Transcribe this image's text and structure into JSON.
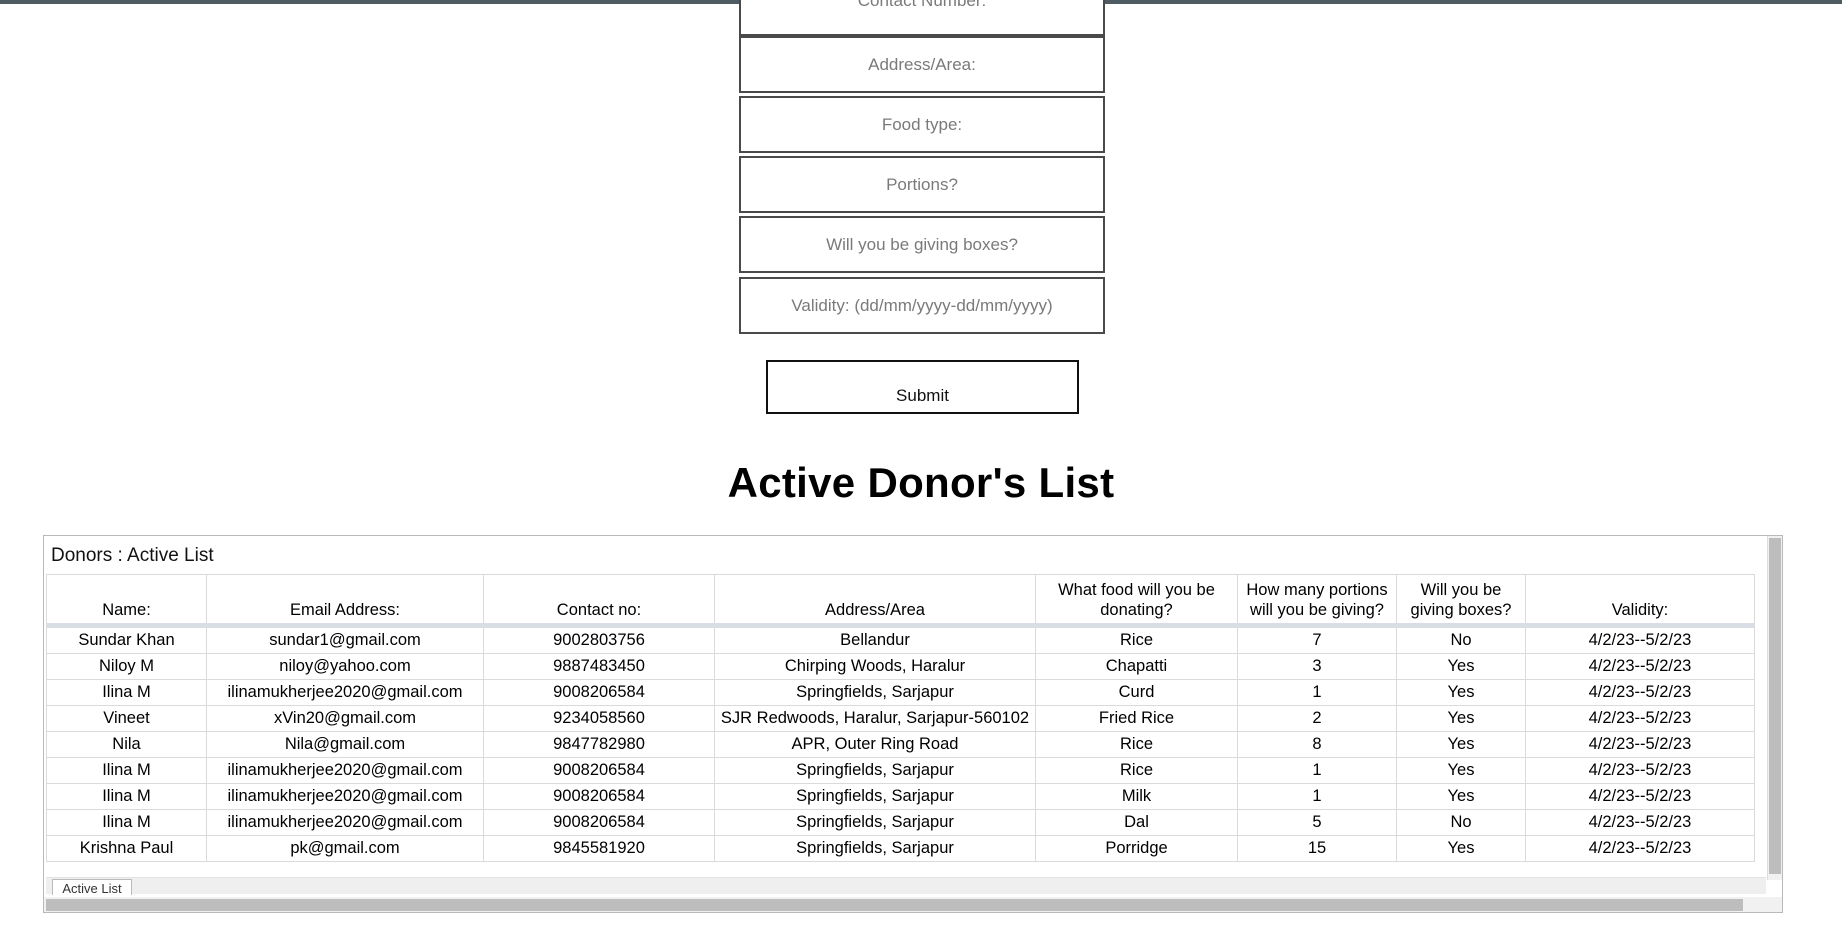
{
  "form": {
    "contact_placeholder": "Contact Number:",
    "address_placeholder": "Address/Area:",
    "food_placeholder": "Food type:",
    "portions_placeholder": "Portions?",
    "boxes_placeholder": "Will you be giving boxes?",
    "validity_placeholder": "Validity: (dd/mm/yyyy-dd/mm/yyyy)",
    "submit_label": "Submit"
  },
  "heading": "Active Donor's List",
  "sheet": {
    "title": "Donors : Active List",
    "tab_label": "Active List",
    "columns": [
      "Name:",
      "Email Address:",
      "Contact no:",
      "Address/Area",
      "What food will you be donating?",
      "How many portions will you be giving?",
      "Will you be giving boxes?",
      "Validity:"
    ],
    "rows": [
      [
        "Sundar Khan",
        "sundar1@gmail.com",
        "9002803756",
        "Bellandur",
        "Rice",
        "7",
        "No",
        "4/2/23--5/2/23"
      ],
      [
        "Niloy M",
        "niloy@yahoo.com",
        "9887483450",
        "Chirping Woods, Haralur",
        "Chapatti",
        "3",
        "Yes",
        "4/2/23--5/2/23"
      ],
      [
        "Ilina M",
        "ilinamukherjee2020@gmail.com",
        "9008206584",
        "Springfields, Sarjapur",
        "Curd",
        "1",
        "Yes",
        "4/2/23--5/2/23"
      ],
      [
        "Vineet",
        "xVin20@gmail.com",
        "9234058560",
        "SJR Redwoods, Haralur, Sarjapur-560102",
        "Fried Rice",
        "2",
        "Yes",
        "4/2/23--5/2/23"
      ],
      [
        "Nila",
        "Nila@gmail.com",
        "9847782980",
        "APR, Outer Ring Road",
        "Rice",
        "8",
        "Yes",
        "4/2/23--5/2/23"
      ],
      [
        "Ilina M",
        "ilinamukherjee2020@gmail.com",
        "9008206584",
        "Springfields, Sarjapur",
        "Rice",
        "1",
        "Yes",
        "4/2/23--5/2/23"
      ],
      [
        "Ilina M",
        "ilinamukherjee2020@gmail.com",
        "9008206584",
        "Springfields, Sarjapur",
        "Milk",
        "1",
        "Yes",
        "4/2/23--5/2/23"
      ],
      [
        "Ilina M",
        "ilinamukherjee2020@gmail.com",
        "9008206584",
        "Springfields, Sarjapur",
        "Dal",
        "5",
        "No",
        "4/2/23--5/2/23"
      ],
      [
        "Krishna Paul",
        "pk@gmail.com",
        "9845581920",
        "Springfields, Sarjapur",
        "Porridge",
        "15",
        "Yes",
        "4/2/23--5/2/23"
      ]
    ]
  }
}
